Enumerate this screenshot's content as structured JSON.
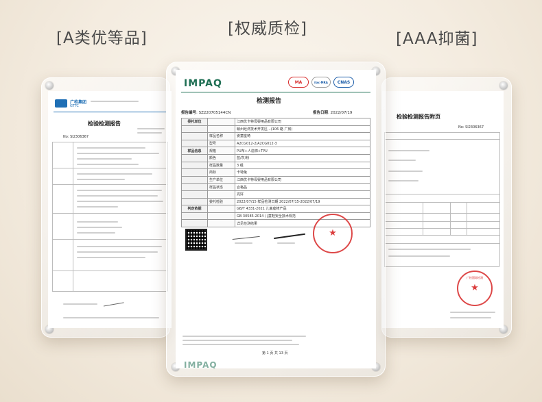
{
  "headings": {
    "left": "[A类优等品]",
    "center": "[权威质检]",
    "right": "[AAA抑菌]"
  },
  "left_doc": {
    "org_name": "广检集团",
    "org_sub": "GTTC",
    "title": "检验检测报告",
    "report_no_label": "No:",
    "report_no": "SI2306367"
  },
  "center_doc": {
    "brand": "IMPAQ",
    "badges": [
      "MA",
      "ilac-MRA",
      "CNAS"
    ],
    "title": "检测报告",
    "report_no_label": "报告编号",
    "report_no": "SZ220705144CN",
    "date_label": "报告日期",
    "date": "2022/07/19",
    "rows": [
      {
        "group": "委托单位",
        "key": "",
        "value": "江西优卡特母婴用品有限公司"
      },
      {
        "group": "",
        "key": "",
        "value": "赣州经济技术开发区...(106 路 厂房)"
      },
      {
        "group": "",
        "key": "样品名称",
        "value": "婴童座椅"
      },
      {
        "group": "",
        "key": "型号",
        "value": "A2CG012-2/A2CG012-3"
      },
      {
        "group": "样品信息",
        "key": "规格",
        "value": "PU布+人造棉+TPU"
      },
      {
        "group": "",
        "key": "颜色",
        "value": "蓝/灰/粉"
      },
      {
        "group": "",
        "key": "样品数量",
        "value": "3 组"
      },
      {
        "group": "",
        "key": "商标",
        "value": "卡特兔"
      },
      {
        "group": "",
        "key": "生产单位",
        "value": "江西优卡特母婴用品有限公司"
      },
      {
        "group": "",
        "key": "样品状态",
        "value": "合格品"
      },
      {
        "group": "",
        "key": "",
        "value": "完好"
      },
      {
        "group": "",
        "key": "委托检验",
        "value": "2022/07/15    样品检测日期    2022/07/15-2022/07/19"
      },
      {
        "group": "判定依据",
        "key": "",
        "value": "GB/T 4331-2021 儿童座椅产品"
      },
      {
        "group": "",
        "key": "",
        "value": "GB 30585-2014 儿童鞋安全技术规范"
      },
      {
        "group": "",
        "key": "",
        "value": "详见检测结果"
      }
    ],
    "page_no": "第 1 页 共 13 页",
    "footer_brand": "IMPAQ"
  },
  "right_doc": {
    "title": "检验检测报告附页",
    "report_no_label": "No:",
    "report_no": "SI2306367",
    "stamp_text": "广检国际检测"
  },
  "colors": {
    "impaq_green": "#1f6f54",
    "stamp_red": "#d72828",
    "cnas_blue": "#1a5ca8",
    "gttc_blue": "#1f6fb5"
  }
}
